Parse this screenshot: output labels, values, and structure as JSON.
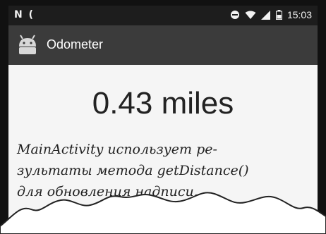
{
  "status_bar": {
    "left_icons": [
      "n-notification-icon",
      "moon-icon"
    ],
    "right_icons": [
      "do-not-disturb-icon",
      "wifi-icon",
      "cell-signal-icon",
      "battery-icon"
    ],
    "time": "15:03"
  },
  "action_bar": {
    "app_icon": "android-icon",
    "title": "Odometer"
  },
  "main": {
    "distance": "0.43 miles"
  },
  "annotation": {
    "line1": "MainActivity использует ре-",
    "line2": "зультаты метода getDistance()",
    "line3": "для обновления надписи."
  },
  "colors": {
    "status_bar": "#1d1d1d",
    "action_bar": "#3b3b3b",
    "content_bg": "#f5f5f5"
  }
}
